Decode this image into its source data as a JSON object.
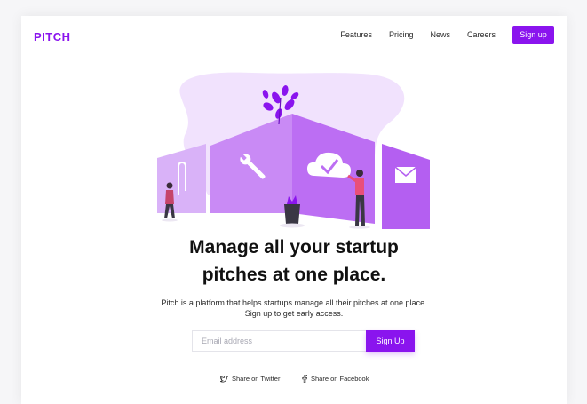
{
  "brand": {
    "logo": "PITCH",
    "accent": "#8a14ee"
  },
  "nav": {
    "links": [
      "Features",
      "Pricing",
      "News",
      "Careers"
    ],
    "cta": "Sign up"
  },
  "hero": {
    "headline_line1": "Manage all your startup",
    "headline_line2": "pitches at one place.",
    "sub_line1": "Pitch is a platform that helps startups manage all their pitches at one place.",
    "sub_line2": "Sign up to get early access."
  },
  "form": {
    "email_placeholder": "Email address",
    "email_value": "",
    "submit_label": "Sign Up"
  },
  "share": {
    "twitter": "Share on Twitter",
    "facebook": "Share on Facebook"
  },
  "icons": [
    "wrench-icon",
    "cloud-check-icon",
    "paperclip-icon",
    "mail-icon",
    "twitter-icon",
    "facebook-icon"
  ]
}
